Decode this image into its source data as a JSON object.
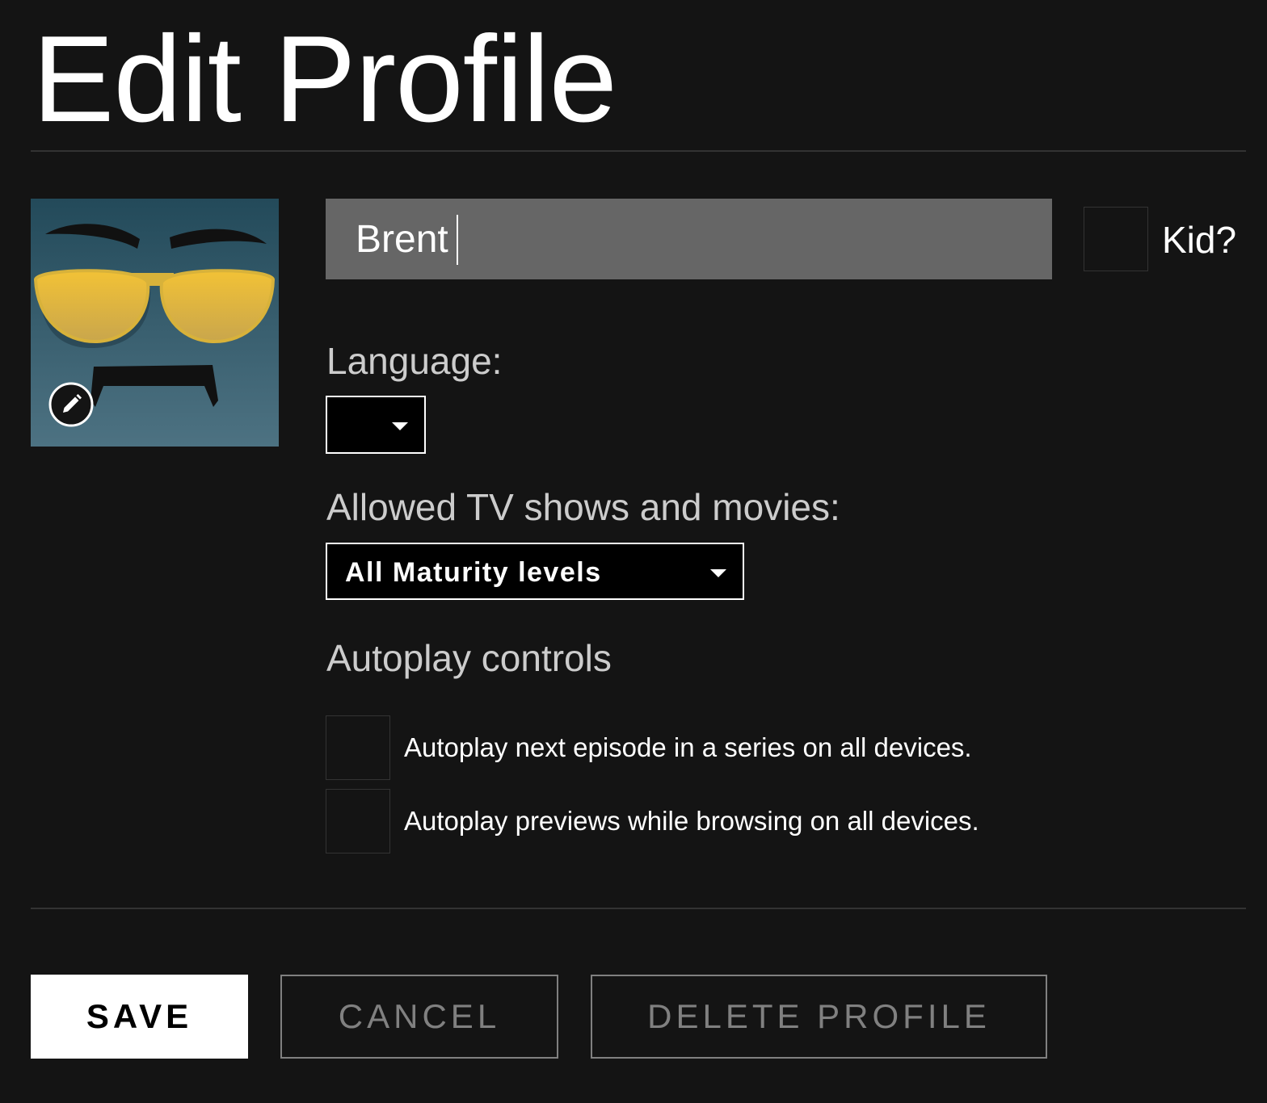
{
  "header": {
    "title": "Edit Profile"
  },
  "profile": {
    "avatar_icon": "mustache-sunglasses-avatar",
    "edit_icon": "pencil-icon",
    "name_value": "Brent",
    "kid_label": "Kid?",
    "kid_checked": false
  },
  "language": {
    "label": "Language:",
    "selected": ""
  },
  "maturity": {
    "label": "Allowed TV shows and movies:",
    "selected": "All Maturity levels"
  },
  "autoplay": {
    "label": "Autoplay controls",
    "options": [
      {
        "label": "Autoplay next episode in a series on all devices.",
        "checked": false
      },
      {
        "label": "Autoplay previews while browsing on all devices.",
        "checked": false
      }
    ]
  },
  "actions": {
    "save_label": "SAVE",
    "cancel_label": "CANCEL",
    "delete_label": "DELETE PROFILE"
  },
  "colors": {
    "background": "#141414",
    "input_background": "#666666",
    "divider": "#333333",
    "muted_button": "#808080",
    "avatar_gold": "#E8B93C"
  }
}
